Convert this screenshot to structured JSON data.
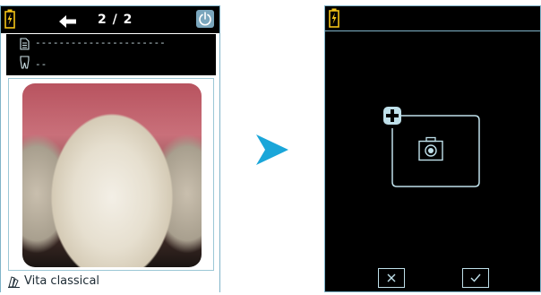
{
  "left_screen": {
    "header": {
      "battery_icon": "battery-charging-icon",
      "back_icon": "arrow-left-icon",
      "page_indicator": "2 / 2",
      "power_icon": "power-icon"
    },
    "info": {
      "document_icon": "document-icon",
      "patient_line": "----------------------",
      "tooth_icon": "tooth-icon",
      "tooth_line": "--"
    },
    "photo": {
      "content": "tooth-image"
    },
    "footer": {
      "shade_icon": "shade-guide-icon",
      "shade_label": "Vita classical"
    }
  },
  "transition": {
    "arrow_icon": "chevron-right-arrow-icon",
    "color": "#1aa6d9"
  },
  "right_screen": {
    "header": {
      "battery_icon": "battery-charging-icon"
    },
    "capture": {
      "plus_icon": "plus-icon",
      "camera_icon": "camera-icon"
    },
    "buttons": {
      "cancel_icon": "close-icon",
      "confirm_icon": "check-icon"
    }
  },
  "colors": {
    "accent": "#7fb3c8",
    "screen_bg": "#000000",
    "battery": "#f2c418"
  }
}
